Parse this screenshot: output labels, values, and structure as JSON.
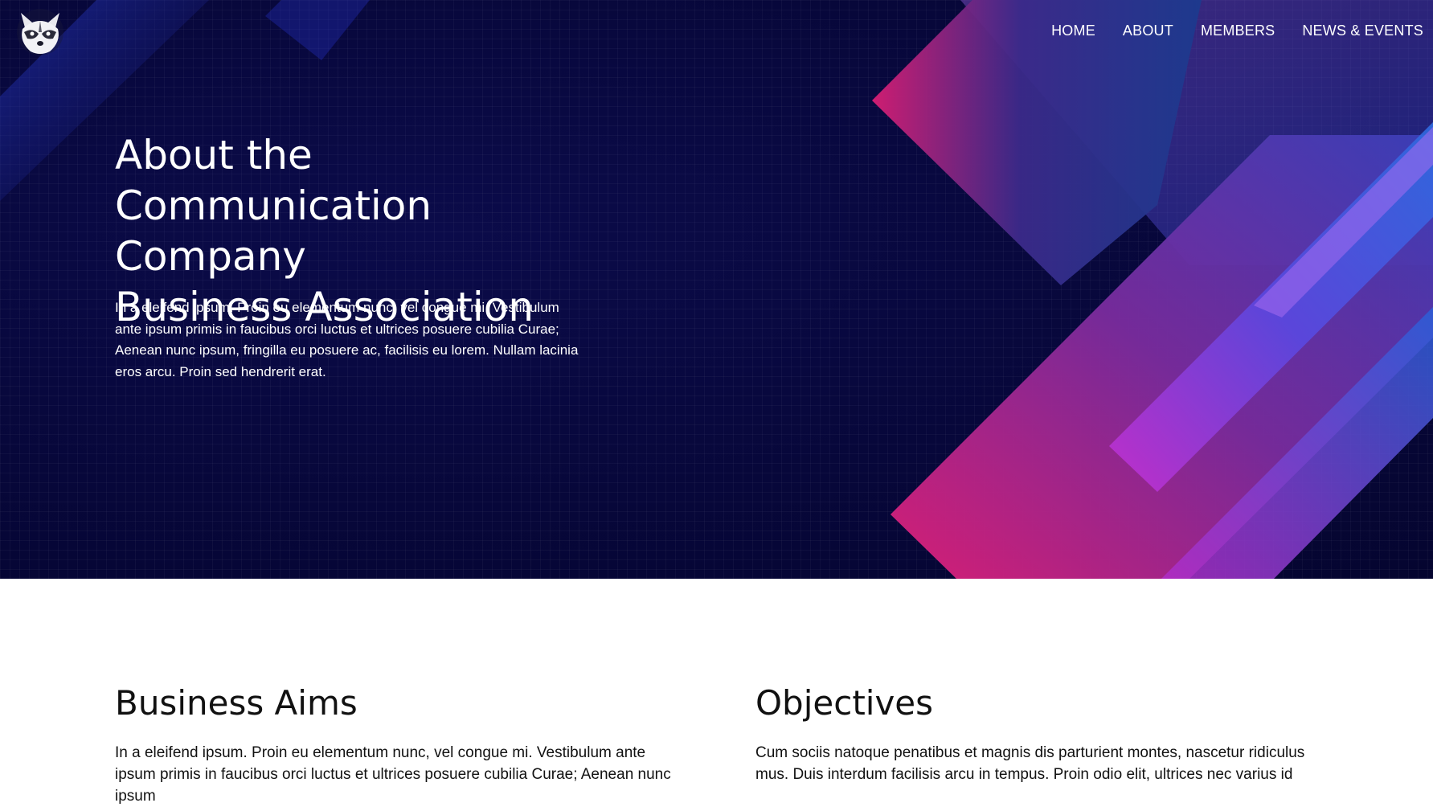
{
  "nav": {
    "items": [
      "HOME",
      "ABOUT",
      "MEMBERS",
      "NEWS & EVENTS"
    ]
  },
  "hero": {
    "title_lines": [
      "About the",
      "Communication Company",
      "Business Association"
    ],
    "text": "In a eleifend ipsum. Proin eu elementum nunc, vel congue mi. Vestibulum ante ipsum primis in faucibus orci luctus et ultrices posuere cubilia Curae; Aenean nunc ipsum, fringilla eu posuere ac, facilisis eu lorem. Nullam lacinia eros arcu. Proin sed hendrerit erat."
  },
  "sections": {
    "aims": {
      "title": "Business Aims",
      "text": "In a eleifend ipsum. Proin eu elementum nunc, vel congue mi. Vestibulum ante ipsum primis in faucibus orci luctus et ultrices posuere cubilia Curae; Aenean nunc ipsum"
    },
    "objectives": {
      "title": "Objectives",
      "text": "Cum sociis natoque penatibus et magnis dis parturient montes, nascetur ridiculus mus. Duis interdum facilisis arcu in tempus. Proin odio elit, ultrices nec varius id"
    }
  },
  "colors": {
    "hero_bg": "#07073a",
    "accent_pink": "#e0207a",
    "accent_blue": "#2a4fd6",
    "accent_purple": "#7a3fd0"
  },
  "icons": {
    "logo": "raccoon-logo-icon"
  }
}
